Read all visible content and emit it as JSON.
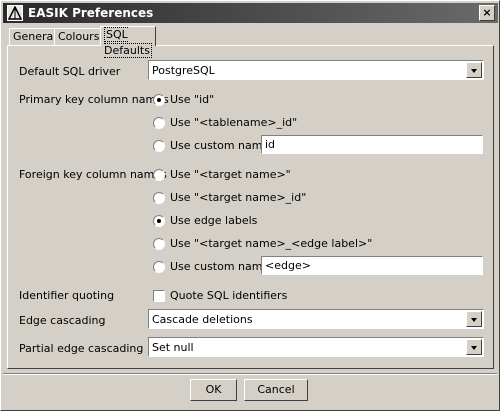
{
  "window": {
    "title": "EASIK Preferences",
    "close_glyph": "×"
  },
  "tabs": [
    {
      "label": "General"
    },
    {
      "label": "Colours"
    },
    {
      "label": "SQL Defaults"
    }
  ],
  "form": {
    "driver_label": "Default SQL driver",
    "driver_value": "PostgreSQL",
    "pk_label": "Primary key column names",
    "pk_options": [
      {
        "label": "Use \"id\"",
        "checked": true
      },
      {
        "label": "Use \"<tablename>_id\"",
        "checked": false
      },
      {
        "label": "Use custom name:",
        "checked": false
      }
    ],
    "pk_custom_value": "id",
    "fk_label": "Foreign key column names",
    "fk_options": [
      {
        "label": "Use \"<target name>\"",
        "checked": false
      },
      {
        "label": "Use \"<target name>_id\"",
        "checked": false
      },
      {
        "label": "Use edge labels",
        "checked": true
      },
      {
        "label": "Use \"<target name>_<edge label>\"",
        "checked": false
      },
      {
        "label": "Use custom name:",
        "checked": false
      }
    ],
    "fk_custom_value": "<edge>",
    "quoting_label": "Identifier quoting",
    "quoting_checkbox_label": "Quote SQL identifiers",
    "quoting_checked": false,
    "edge_cascading_label": "Edge cascading",
    "edge_cascading_value": "Cascade deletions",
    "partial_cascading_label": "Partial edge cascading",
    "partial_cascading_value": "Set null"
  },
  "buttons": {
    "ok": "OK",
    "cancel": "Cancel"
  }
}
